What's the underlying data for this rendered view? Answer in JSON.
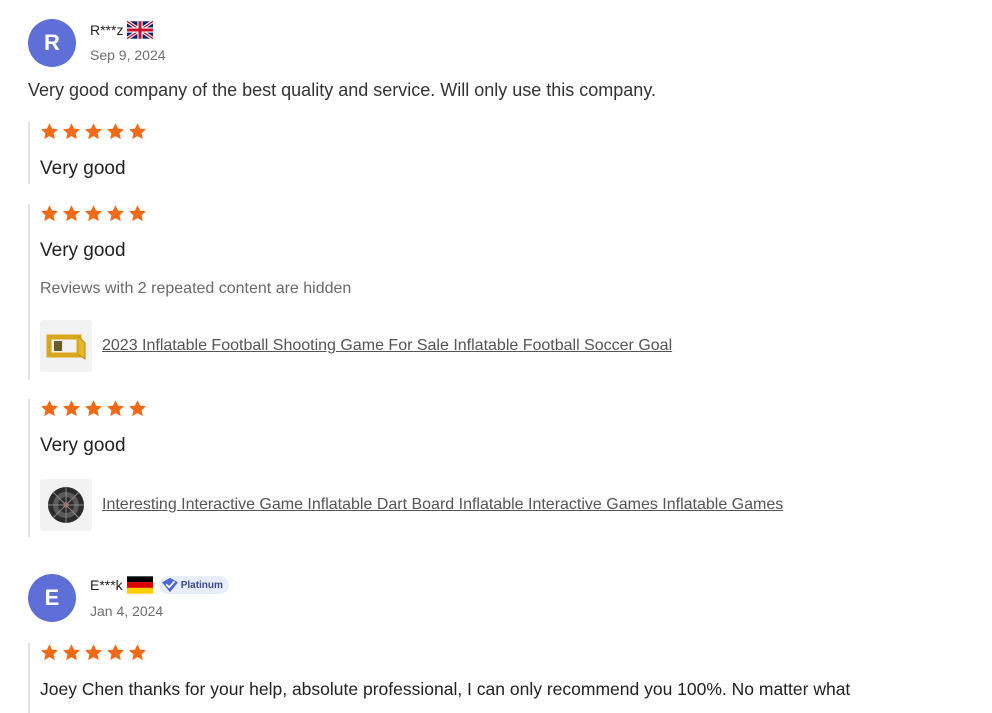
{
  "colors": {
    "star": "#f26a16",
    "avatar": "#5f6fd8",
    "badge_bg": "#e8eefc"
  },
  "reviews": [
    {
      "avatar_letter": "R",
      "name": "R***z",
      "flag_icon": "uk-flag-icon",
      "date": "Sep 9, 2024",
      "summary": "Very good company of the best quality and service. Will only use this company.",
      "blocks": [
        {
          "rating": 5,
          "text": "Very good"
        },
        {
          "rating": 5,
          "text": "Very good",
          "note": "Reviews with 2 repeated content are hidden",
          "product": "2023 Inflatable Football Shooting Game For Sale Inflatable Football Soccer Goal",
          "thumb_icon": "inflatable-goal-icon"
        },
        {
          "rating": 5,
          "text": "Very good",
          "product": "Interesting Interactive Game Inflatable Dart Board Inflatable Interactive Games Inflatable Games",
          "thumb_icon": "dart-board-icon"
        }
      ]
    },
    {
      "avatar_letter": "E",
      "name": "E***k",
      "flag_icon": "germany-flag-icon",
      "badge": "Platinum",
      "date": "Jan 4, 2024",
      "blocks": [
        {
          "rating": 5,
          "text": "Joey Chen thanks for your help, absolute professional, I can only recommend you 100%. No matter what"
        }
      ]
    }
  ]
}
